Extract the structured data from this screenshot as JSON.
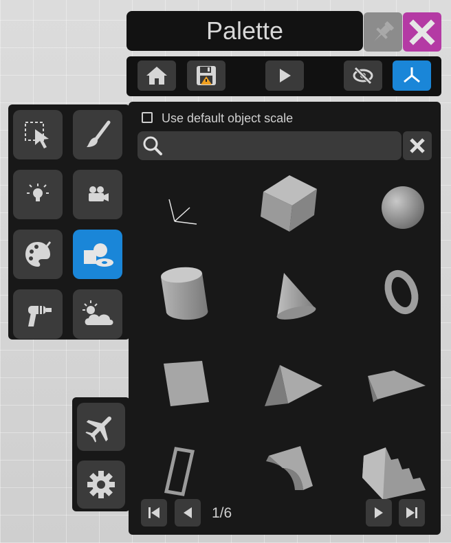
{
  "window": {
    "title": "Palette"
  },
  "options": {
    "default_scale_label": "Use default object scale",
    "default_scale_checked": false
  },
  "search": {
    "value": "",
    "placeholder": ""
  },
  "pager": {
    "label": "1/6"
  },
  "toolbar": {
    "buttons": [
      "home-icon",
      "save-warning-icon",
      "play-icon",
      "eye-slash-icon",
      "axes-icon"
    ],
    "active": "axes-icon"
  },
  "tools": {
    "items": [
      "select-icon",
      "brush-icon",
      "light-icon",
      "camera-icon",
      "palette-icon",
      "shapes-icon",
      "raygun-icon",
      "weather-icon"
    ],
    "active": "shapes-icon"
  },
  "bottom_tools": [
    "airplane-icon",
    "gear-icon"
  ],
  "objects": [
    "axes-gizmo",
    "cube",
    "sphere",
    "cylinder",
    "cone",
    "torus",
    "plane",
    "prism",
    "wedge",
    "frame",
    "arch",
    "stairs"
  ],
  "colors": {
    "accent": "#1a86d8",
    "close": "#b43aa4",
    "pin": "#8c8c8c"
  }
}
